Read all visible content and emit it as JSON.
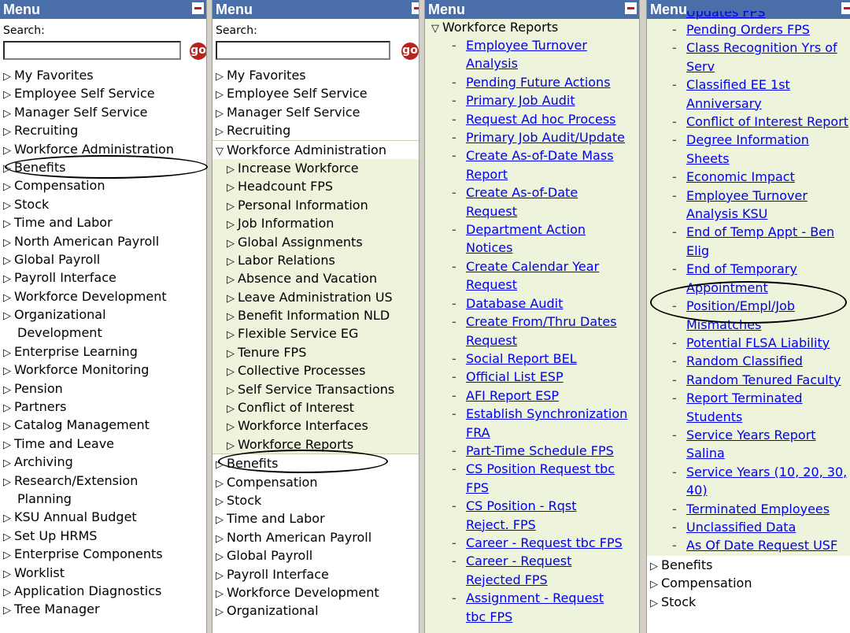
{
  "header_title": "Menu",
  "search_label": "Search:",
  "go_label": "go",
  "panel1_items": [
    "My Favorites",
    "Employee Self Service",
    "Manager Self Service",
    "Recruiting",
    "Workforce Administration",
    "Benefits",
    "Compensation",
    "Stock",
    "Time and Labor",
    "North American Payroll",
    "Global Payroll",
    "Payroll Interface",
    "Workforce Development",
    "Organizational",
    "Development",
    "Enterprise Learning",
    "Workforce Monitoring",
    "Pension",
    "Partners",
    "Catalog Management",
    "Time and Leave",
    "Archiving",
    "Research/Extension",
    "Planning",
    "KSU Annual Budget",
    "Set Up HRMS",
    "Enterprise Components",
    "Worklist",
    "Application Diagnostics",
    "Tree Manager"
  ],
  "panel2_top_items": [
    "My Favorites",
    "Employee Self Service",
    "Manager Self Service",
    "Recruiting"
  ],
  "panel2_expanded": "Workforce Administration",
  "panel2_sub_items": [
    "Increase Workforce",
    "Headcount FPS",
    "Personal Information",
    "Job Information",
    "Global Assignments",
    "Labor Relations",
    "Absence and Vacation",
    "Leave Administration US",
    "Benefit Information NLD",
    "Flexible Service EG",
    "Tenure FPS",
    "Collective Processes",
    "Self Service Transactions",
    "Conflict of Interest",
    "Workforce Interfaces",
    "Workforce Reports"
  ],
  "panel2_bottom_items": [
    "Benefits",
    "Compensation",
    "Stock",
    "Time and Labor",
    "North American Payroll",
    "Global Payroll",
    "Payroll Interface",
    "Workforce Development",
    "Organizational"
  ],
  "panel3_expanded": "Workforce Reports",
  "panel3_links": [
    [
      "Employee Turnover",
      "Analysis"
    ],
    [
      "Pending Future Actions"
    ],
    [
      "Primary Job Audit"
    ],
    [
      "Request Ad hoc Process"
    ],
    [
      "Primary Job Audit/Update"
    ],
    [
      "Create As-of-Date Mass",
      "Report"
    ],
    [
      "Create As-of-Date",
      "Request"
    ],
    [
      "Department Action",
      "Notices"
    ],
    [
      "Create Calendar Year",
      "Request"
    ],
    [
      "Database Audit"
    ],
    [
      "Create From/Thru Dates",
      "Request"
    ],
    [
      "Social Report BEL"
    ],
    [
      "Official List ESP"
    ],
    [
      "AFI Report ESP"
    ],
    [
      "Establish Synchronization",
      "FRA"
    ],
    [
      "Part-Time Schedule FPS"
    ],
    [
      "CS Position Request tbc",
      "FPS"
    ],
    [
      "CS Position - Rqst",
      "Reject. FPS"
    ],
    [
      "Career - Request tbc FPS"
    ],
    [
      "Career - Request",
      "Rejected FPS"
    ],
    [
      "Assignment - Request",
      "tbc FPS"
    ]
  ],
  "panel4_partial_top": "Updates FPS",
  "panel4_links": [
    [
      "Pending Orders FPS"
    ],
    [
      "Class Recognition Yrs of",
      "Serv"
    ],
    [
      "Classified EE 1st",
      "Anniversary"
    ],
    [
      "Conflict of Interest Report"
    ],
    [
      "Degree Information",
      "Sheets"
    ],
    [
      "Economic Impact"
    ],
    [
      "Employee Turnover",
      "Analysis KSU"
    ],
    [
      "End of Temp Appt - Ben",
      "Elig"
    ],
    [
      "End of Temporary",
      "Appointment"
    ],
    [
      "Position/Empl/Job",
      "Mismatches"
    ],
    [
      "Potential FLSA Liability"
    ],
    [
      "Random Classified"
    ],
    [
      "Random Tenured Faculty"
    ],
    [
      "Report Terminated",
      "Students"
    ],
    [
      "Service Years Report",
      "Salina"
    ],
    [
      "Service Years (10, 20, 30,",
      "40)"
    ],
    [
      "Terminated Employees"
    ],
    [
      "Unclassified Data"
    ],
    [
      "As Of Date Request USF"
    ]
  ],
  "panel4_bottom_items": [
    "Benefits",
    "Compensation",
    "Stock"
  ]
}
